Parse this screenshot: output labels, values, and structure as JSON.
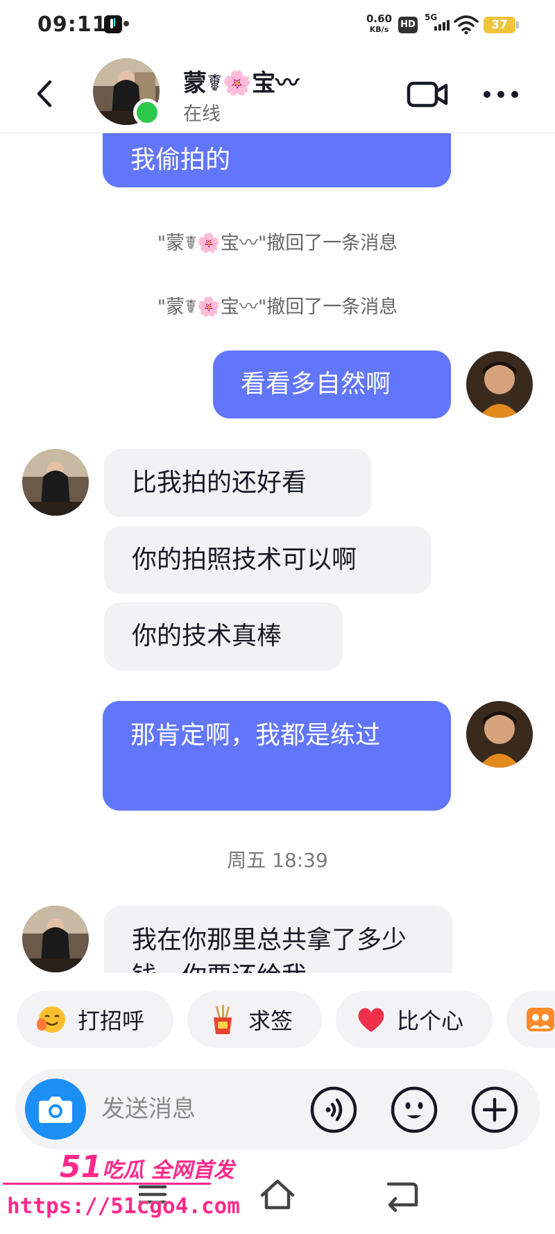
{
  "status_bar": {
    "time": "09:11",
    "net_speed": "0.60",
    "net_speed_unit": "KB/s",
    "hd": "HD",
    "network": "5G",
    "battery": "37"
  },
  "header": {
    "contact_name": "蒙☤🌸宝〰",
    "status": "在线"
  },
  "messages": {
    "m1": "我偷拍的",
    "recall1": "\"蒙☤🌸宝〰\"撤回了一条消息",
    "recall2": "\"蒙☤🌸宝〰\"撤回了一条消息",
    "m2": "看看多自然啊",
    "m3": "比我拍的还好看",
    "m4": "你的拍照技术可以啊",
    "m5": "你的技术真棒",
    "m6": "那肯定啊，我都是练过",
    "time1": "周五 18:39",
    "m7": "我在你那里总共拿了多少钱，你要还给我"
  },
  "quick_replies": [
    {
      "label": "打招呼",
      "icon": "smile-hand-icon"
    },
    {
      "label": "求签",
      "icon": "fortune-sticks-icon"
    },
    {
      "label": "比个心",
      "icon": "heart-icon"
    },
    {
      "label": "",
      "icon": "group-icon"
    }
  ],
  "input": {
    "placeholder": "发送消息"
  },
  "watermark": {
    "title_num": "51",
    "title_text": "吃瓜 全网首发",
    "url": "https://51cgo4.com"
  },
  "colors": {
    "my_bubble": "#6276fb",
    "their_bubble": "#f2f2f4",
    "online": "#2bc84a",
    "camera": "#1c8ff5",
    "watermark": "#ff2a8a"
  }
}
